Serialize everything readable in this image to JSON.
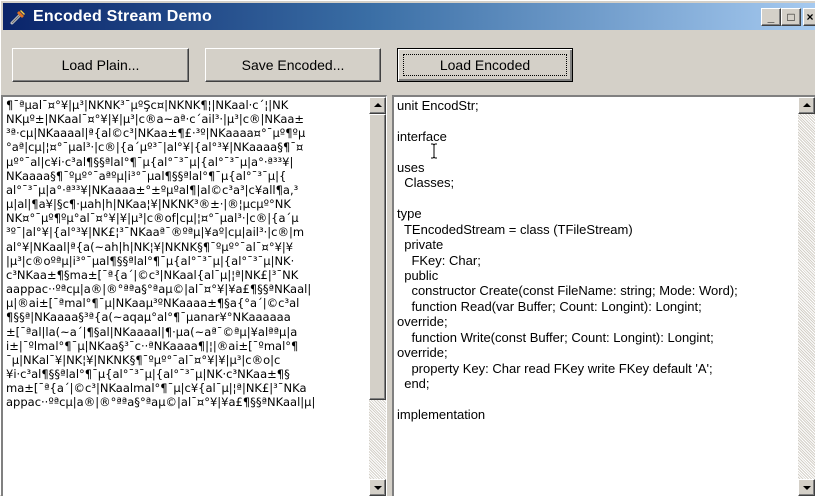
{
  "window": {
    "title": "Encoded Stream Demo",
    "caption_buttons": {
      "minimize": "_",
      "maximize": "□",
      "close": "×"
    }
  },
  "toolbar": {
    "load_plain_label": "Load Plain...",
    "save_encoded_label": "Save Encoded...",
    "load_encoded_label": "Load Encoded"
  },
  "left_memo": {
    "lines": [
      "¶¯ªµal¯¤°¥|µ³|NKNK³¯µºŞc¤|NKNK¶¦|NKaal·c´¦|NK",
      "NKµº±|NKaal¯¤°¥|¥|µ³|c®a~aª·c´ail³·|µ³|c®|NKaa±",
      "³ª·cµ|NKaaaal|ª{al©c³|NKaa±¶£·³º|NKaaaa¤°¯µº¶ºµ",
      "°aª|cµ|¦¤°¯µal³·|c®|{a´µº³¯|al°¥|{al°³¥|NKaaaa§¶¯¤",
      "µº°¯al|c¥i·c³al¶§§ªlal°¶¯µ{al°¯³¯µ|{al°¯³¯µ|a°·ª³³¥|",
      "NKaaaa§¶¯ºµº°¯aªºµ|i³°¯µal¶§§ªlal°¶¯µ{al°¯³¯µ|{",
      "al°¯³¯µ|a°·ª³³¥|NKaaaa±°±ºµºal¶|al©c³a³|c¥all¶a,³",
      "µ|al|¶a¥|§c¶·µah|h|NKaa¦¥|NKNK³®±·|®¦µcµº°NK",
      "NK¤°¯µº¶ºµ°al¯¤°¥|¥|µ³|c®of|cµ|¦¤°¯µal³·|c®|{a´µ",
      "³º¯|al°¥|{al°³¥|NK£¦³¯NKaaª¯®ºªµ|¥aº|cµ|ail³·|c®|m",
      "al°¥|NKaal|ª{a(~ah|h|NK¦¥|NKNK§¶¯ºµº°¯al¯¤°¥|¥",
      "|µ³|c®oºªµ|i³°¯µal¶§§ªlal°¶¯µ{al°¯³¯µ|{al°¯³¯µ|NK·",
      "c³NKaa±¶§ma±[¯ª{a´|©c³|NKaal{al¯µ|¦ª|NK£|³¯NK",
      "aappac··ºªcµ|a®|®°ªªa§°ªaµ©|al¯¤°¥|¥a£¶§§ªNKaal|",
      "µ|®ai±[¯ªmal°¶¯µ|NKaaµ³ºNKaaaa±¶§a{°a´|©c³al",
      "¶§§ª|NKaaaa§³ª{a(~aqaµ°al°¶¯µanar¥°NKaaaaaa",
      "±[¯ªal|la(~a´|¶§al|NKaaaal|¶·µa(~aª¯©ªµ|¥alªªµ|a",
      "i±|¯ºlmal°¶¯µ|NKaa§³¯c··ªNKaaaa¶|¦|®ai±[¯ºmal°¶",
      "¯µ|NKal¯¥|NK¦¥|NKNK§¶¯ºµº°¯al¯¤°¥|¥|µ³|c®o|c",
      "¥i·c³al¶§§ªlal°¶¯µ{al°¯³¯µ|{al°¯³¯µ|NK·c³NKaa±¶§",
      "ma±[¯ª{a´|©c³|NKaalmal°¶¯µ|c¥{al¯µ|¦ª|NK£|³¯NKa",
      "appac··ºªcµ|a®|®°ªªa§°ªaµ©|al¯¤°¥|¥a£¶§§ªNKaal|µ|"
    ]
  },
  "right_memo": {
    "lines": [
      "unit EncodStr;",
      "",
      "interface",
      "",
      "uses",
      "  Classes;",
      "",
      "type",
      "  TEncodedStream = class (TFileStream)",
      "  private",
      "    FKey: Char;",
      "  public",
      "    constructor Create(const FileName: string; Mode: Word);",
      "    function Read(var Buffer; Count: Longint): Longint;",
      "override;",
      "    function Write(const Buffer; Count: Longint): Longint;",
      "override;",
      "    property Key: Char read FKey write FKey default 'A';",
      "  end;",
      "",
      "implementation",
      ""
    ]
  },
  "colors": {
    "title_gradient_start": "#0a246a",
    "title_gradient_end": "#a6caf0",
    "face": "#d4d0c8",
    "memo_background": "#ffffff"
  },
  "icons": {
    "app_icon": "wrench-icon",
    "cursor": "text-cursor-icon"
  }
}
